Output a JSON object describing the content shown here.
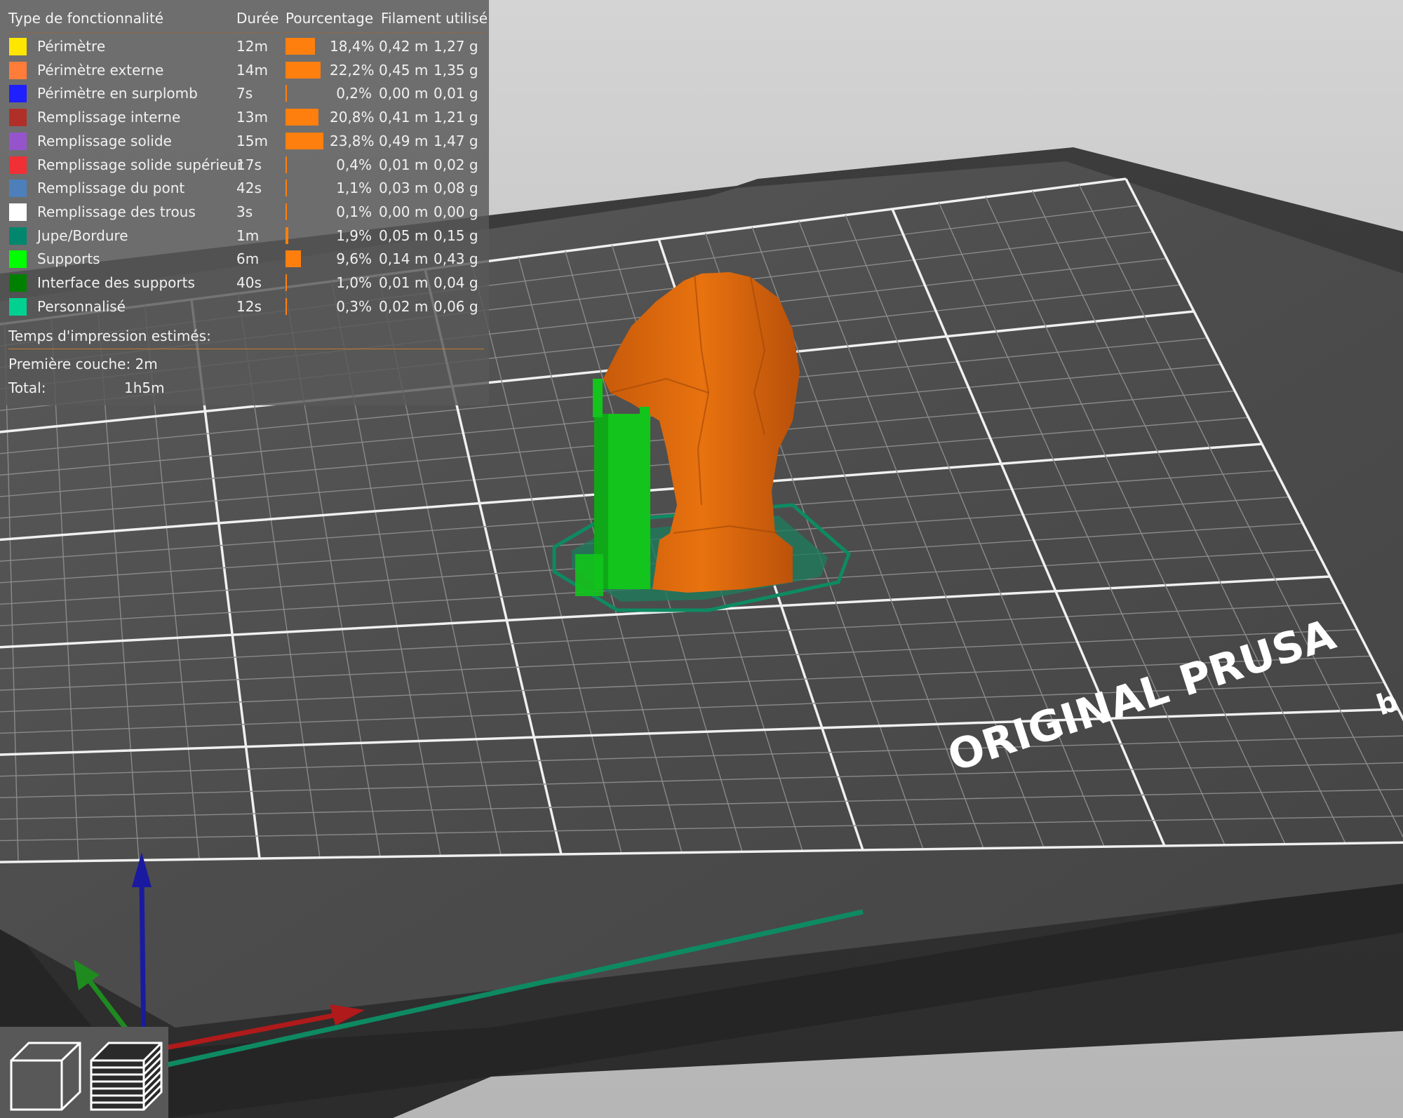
{
  "legend": {
    "headers": {
      "type": "Type de fonctionnalité",
      "duration": "Durée",
      "percentage": "Pourcentage",
      "filament": "Filament utilisé"
    },
    "rows": [
      {
        "name": "Périmètre",
        "color": "#FFE600",
        "time": "12m",
        "pct_value": 18.4,
        "pct": "18,4%",
        "length": "0,42 m",
        "weight": "1,27 g"
      },
      {
        "name": "Périmètre externe",
        "color": "#FF7D38",
        "time": "14m",
        "pct_value": 22.2,
        "pct": "22,2%",
        "length": "0,45 m",
        "weight": "1,35 g"
      },
      {
        "name": "Périmètre en surplomb",
        "color": "#1F1FFF",
        "time": "7s",
        "pct_value": 0.2,
        "pct": "0,2%",
        "length": "0,00 m",
        "weight": "0,01 g"
      },
      {
        "name": "Remplissage interne",
        "color": "#B03029",
        "time": "13m",
        "pct_value": 20.8,
        "pct": "20,8%",
        "length": "0,41 m",
        "weight": "1,21 g"
      },
      {
        "name": "Remplissage solide",
        "color": "#9654CC",
        "time": "15m",
        "pct_value": 23.8,
        "pct": "23,8%",
        "length": "0,49 m",
        "weight": "1,47 g"
      },
      {
        "name": "Remplissage solide supérieur",
        "color": "#F03035",
        "time": "17s",
        "pct_value": 0.4,
        "pct": "0,4%",
        "length": "0,01 m",
        "weight": "0,02 g"
      },
      {
        "name": "Remplissage du pont",
        "color": "#4D80BA",
        "time": "42s",
        "pct_value": 1.1,
        "pct": "1,1%",
        "length": "0,03 m",
        "weight": "0,08 g"
      },
      {
        "name": "Remplissage des trous",
        "color": "#FFFFFF",
        "time": "3s",
        "pct_value": 0.1,
        "pct": "0,1%",
        "length": "0,00 m",
        "weight": "0,00 g"
      },
      {
        "name": "Jupe/Bordure",
        "color": "#00876E",
        "time": "1m",
        "pct_value": 1.9,
        "pct": "1,9%",
        "length": "0,05 m",
        "weight": "0,15 g"
      },
      {
        "name": "Supports",
        "color": "#00FF00",
        "time": "6m",
        "pct_value": 9.6,
        "pct": "9,6%",
        "length": "0,14 m",
        "weight": "0,43 g"
      },
      {
        "name": "Interface des supports",
        "color": "#008000",
        "time": "40s",
        "pct_value": 1.0,
        "pct": "1,0%",
        "length": "0,01 m",
        "weight": "0,04 g"
      },
      {
        "name": "Personnalisé",
        "color": "#00D090",
        "time": "12s",
        "pct_value": 0.3,
        "pct": "0,3%",
        "length": "0,02 m",
        "weight": "0,06 g"
      }
    ],
    "estimates": {
      "title": "Temps d'impression estimés:",
      "first_layer": "Première couche: 2m",
      "total_label": "Total:",
      "total_value": "1h5m"
    }
  },
  "bed": {
    "brand_text": "ORIGINAL PRUSA",
    "partial_text": "b"
  },
  "view_buttons": [
    {
      "name": "3d-view-button",
      "icon": "cube-icon"
    },
    {
      "name": "layers-view-button",
      "icon": "layers-icon"
    }
  ],
  "colors": {
    "accent": "#FF7F0E",
    "model": "#E66A0F",
    "support": "#12C41C",
    "skirt": "#0E8A62"
  }
}
